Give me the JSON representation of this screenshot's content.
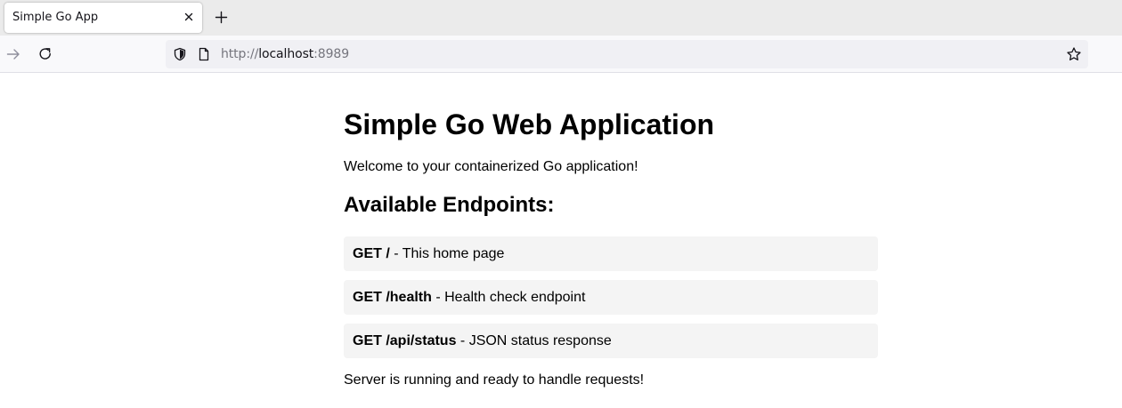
{
  "browser": {
    "tab_title": "Simple Go App",
    "url": {
      "scheme": "http://",
      "host": "localhost",
      "port": ":8989"
    },
    "icons": {
      "tab_close": "close-icon",
      "new_tab": "plus-icon",
      "back": "arrow-right-icon",
      "reload": "reload-icon",
      "site_info": "shield-icon",
      "page": "page-icon",
      "bookmark": "star-icon"
    }
  },
  "page": {
    "title": "Simple Go Web Application",
    "welcome": "Welcome to your containerized Go application!",
    "endpoints_heading": "Available Endpoints:",
    "endpoints": [
      {
        "route": "GET /",
        "description": " - This home page"
      },
      {
        "route": "GET /health",
        "description": " - Health check endpoint"
      },
      {
        "route": "GET /api/status",
        "description": " - JSON status response"
      }
    ],
    "status": "Server is running and ready to handle requests!"
  },
  "colors": {
    "tabbar_bg": "#ebebeb",
    "navbar_bg": "#f9f9fb",
    "urlbar_bg": "#f0f0f4",
    "endpoint_bg": "#f4f4f4",
    "muted_text": "#75757d"
  }
}
